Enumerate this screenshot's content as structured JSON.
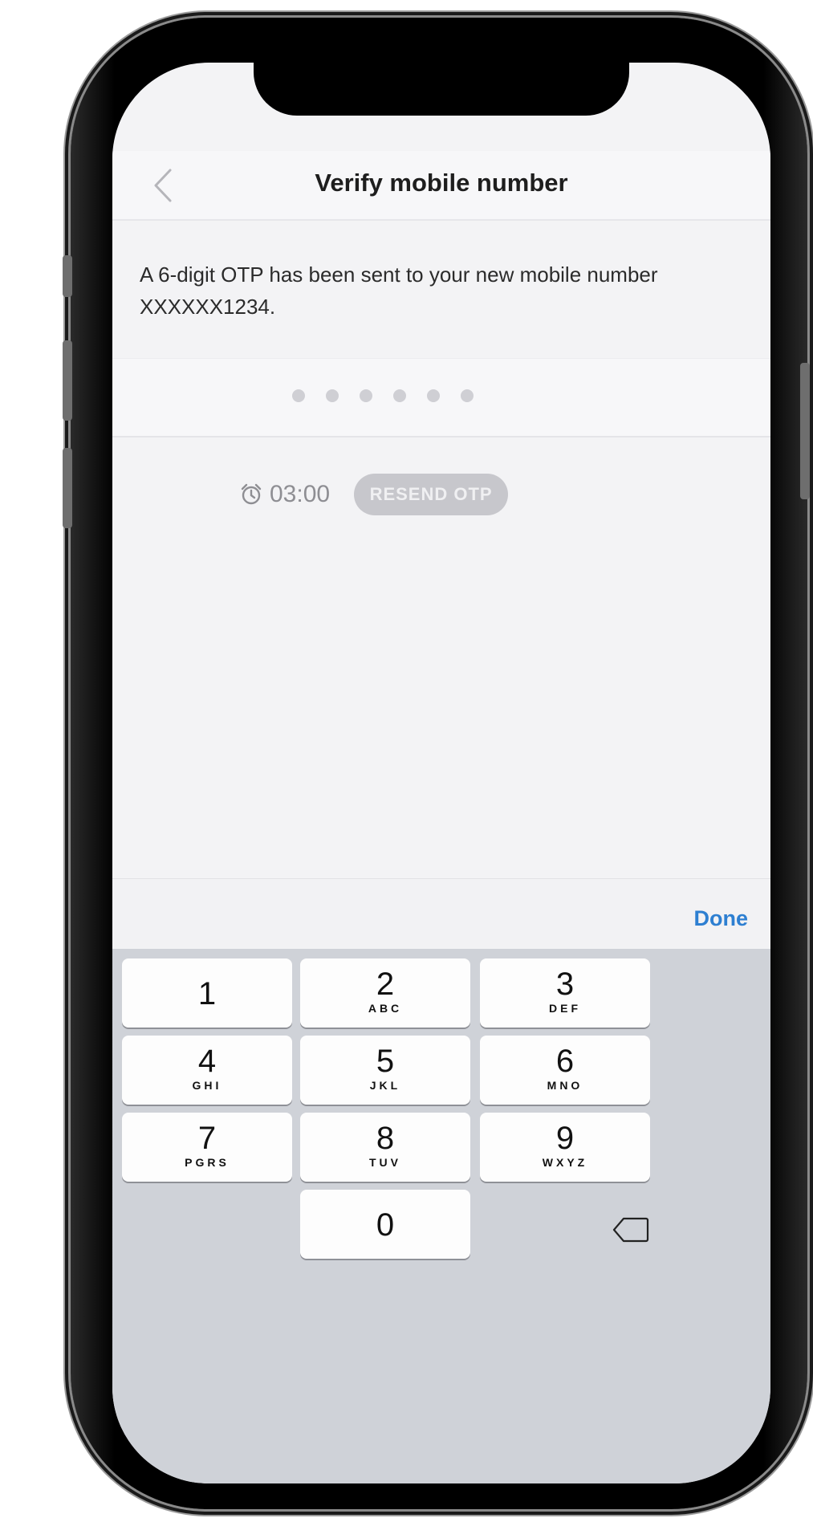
{
  "nav": {
    "title": "Verify mobile number",
    "back_icon": "chevron-left-icon"
  },
  "message": "A 6-digit OTP has been sent to your new mobile number XXXXXX1234.",
  "otp": {
    "length": 6
  },
  "timer": {
    "value": "03:00",
    "icon": "alarm-clock-icon"
  },
  "resend": {
    "label": "RESEND OTP",
    "enabled": false
  },
  "keyboard": {
    "done_label": "Done",
    "keys": [
      {
        "digit": "1",
        "letters": ""
      },
      {
        "digit": "2",
        "letters": "ABC"
      },
      {
        "digit": "3",
        "letters": "DEF"
      },
      {
        "digit": "4",
        "letters": "GHI"
      },
      {
        "digit": "5",
        "letters": "JKL"
      },
      {
        "digit": "6",
        "letters": "MNO"
      },
      {
        "digit": "7",
        "letters": "PGRS"
      },
      {
        "digit": "8",
        "letters": "TUV"
      },
      {
        "digit": "9",
        "letters": "WXYZ"
      },
      {
        "digit": "0",
        "letters": ""
      }
    ],
    "delete_icon": "backspace-icon"
  },
  "colors": {
    "accent": "#2d7fd1",
    "disabled": "#c7c7cc",
    "keyboard_bg": "#cfd2d8"
  }
}
